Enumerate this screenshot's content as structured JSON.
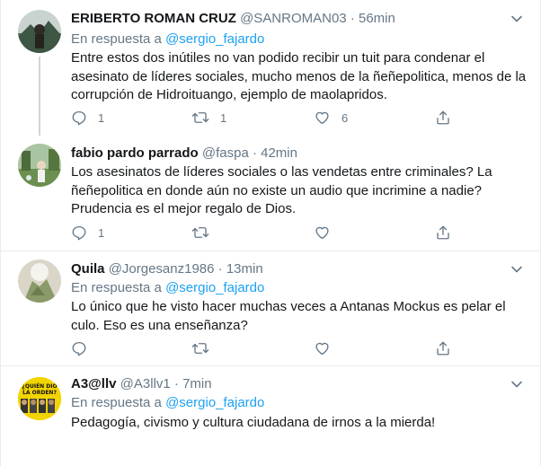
{
  "tweets": [
    {
      "name": "ERIBERTO ROMAN CRUZ",
      "handle": "@SANROMAN03",
      "sep": "·",
      "time": "56min",
      "reply_prefix": "En respuesta a",
      "reply_to": "@sergio_fajardo",
      "text": "Entre estos dos inútiles no van podido recibir un tuit para condenar el asesinato de líderes sociales, mucho menos de la ñeñepolitica, menos de la corrupción de Hidroituango, ejemplo de maolapridos.",
      "replies": "1",
      "retweets": "1",
      "likes": "6"
    },
    {
      "name": "fabio pardo parrado",
      "handle": "@faspa",
      "sep": "·",
      "time": "42min",
      "text": "Los asesinatos de líderes sociales o las vendetas entre criminales? La ñeñepolitica en donde aún no existe un audio que incrimine a nadie? Prudencia es el mejor regalo de Dios.",
      "replies": "1",
      "retweets": "",
      "likes": ""
    },
    {
      "name": "Quila",
      "handle": "@Jorgesanz1986",
      "sep": "·",
      "time": "13min",
      "reply_prefix": "En respuesta a",
      "reply_to": "@sergio_fajardo",
      "text": "Lo único que he visto hacer muchas veces a Antanas Mockus es pelar el culo. Eso es una enseñanza?",
      "replies": "",
      "retweets": "",
      "likes": ""
    },
    {
      "name": "A3@llv",
      "handle": "@A3llv1",
      "sep": "·",
      "time": "7min",
      "reply_prefix": "En respuesta a",
      "reply_to": "@sergio_fajardo",
      "text": "Pedagogía, civismo y cultura ciudadana de irnos a la mierda!",
      "avatar_text": "¿QUIÉN DIO LA ORDEN?"
    }
  ],
  "icons": {
    "reply": "reply-icon",
    "retweet": "retweet-icon",
    "like": "heart-icon",
    "share": "share-icon",
    "more": "chevron-down-icon"
  },
  "colors": {
    "accent": "#1da1f2",
    "secondary_text": "#657786",
    "border": "#e6ecf0"
  }
}
